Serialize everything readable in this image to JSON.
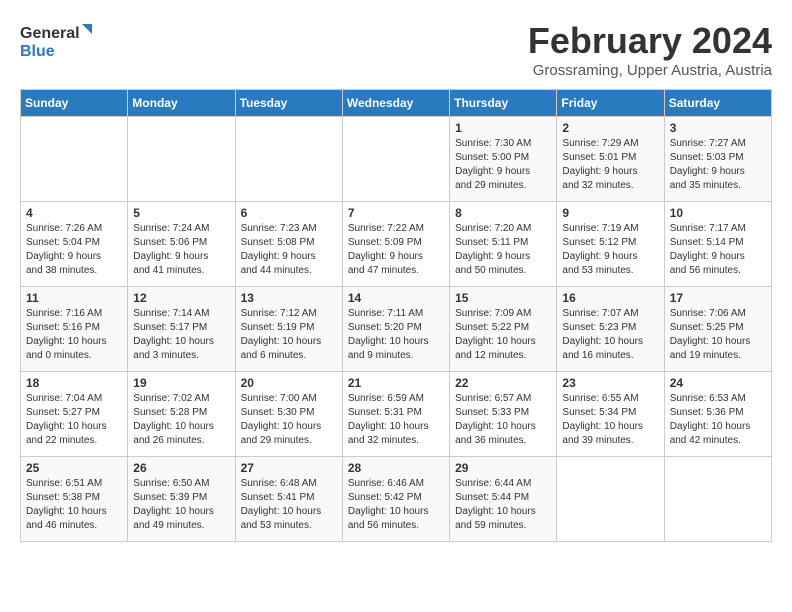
{
  "header": {
    "logo_line1": "General",
    "logo_line2": "Blue",
    "month_year": "February 2024",
    "location": "Grossraming, Upper Austria, Austria"
  },
  "days_of_week": [
    "Sunday",
    "Monday",
    "Tuesday",
    "Wednesday",
    "Thursday",
    "Friday",
    "Saturday"
  ],
  "weeks": [
    [
      {
        "day": "",
        "info": ""
      },
      {
        "day": "",
        "info": ""
      },
      {
        "day": "",
        "info": ""
      },
      {
        "day": "",
        "info": ""
      },
      {
        "day": "1",
        "info": "Sunrise: 7:30 AM\nSunset: 5:00 PM\nDaylight: 9 hours\nand 29 minutes."
      },
      {
        "day": "2",
        "info": "Sunrise: 7:29 AM\nSunset: 5:01 PM\nDaylight: 9 hours\nand 32 minutes."
      },
      {
        "day": "3",
        "info": "Sunrise: 7:27 AM\nSunset: 5:03 PM\nDaylight: 9 hours\nand 35 minutes."
      }
    ],
    [
      {
        "day": "4",
        "info": "Sunrise: 7:26 AM\nSunset: 5:04 PM\nDaylight: 9 hours\nand 38 minutes."
      },
      {
        "day": "5",
        "info": "Sunrise: 7:24 AM\nSunset: 5:06 PM\nDaylight: 9 hours\nand 41 minutes."
      },
      {
        "day": "6",
        "info": "Sunrise: 7:23 AM\nSunset: 5:08 PM\nDaylight: 9 hours\nand 44 minutes."
      },
      {
        "day": "7",
        "info": "Sunrise: 7:22 AM\nSunset: 5:09 PM\nDaylight: 9 hours\nand 47 minutes."
      },
      {
        "day": "8",
        "info": "Sunrise: 7:20 AM\nSunset: 5:11 PM\nDaylight: 9 hours\nand 50 minutes."
      },
      {
        "day": "9",
        "info": "Sunrise: 7:19 AM\nSunset: 5:12 PM\nDaylight: 9 hours\nand 53 minutes."
      },
      {
        "day": "10",
        "info": "Sunrise: 7:17 AM\nSunset: 5:14 PM\nDaylight: 9 hours\nand 56 minutes."
      }
    ],
    [
      {
        "day": "11",
        "info": "Sunrise: 7:16 AM\nSunset: 5:16 PM\nDaylight: 10 hours\nand 0 minutes."
      },
      {
        "day": "12",
        "info": "Sunrise: 7:14 AM\nSunset: 5:17 PM\nDaylight: 10 hours\nand 3 minutes."
      },
      {
        "day": "13",
        "info": "Sunrise: 7:12 AM\nSunset: 5:19 PM\nDaylight: 10 hours\nand 6 minutes."
      },
      {
        "day": "14",
        "info": "Sunrise: 7:11 AM\nSunset: 5:20 PM\nDaylight: 10 hours\nand 9 minutes."
      },
      {
        "day": "15",
        "info": "Sunrise: 7:09 AM\nSunset: 5:22 PM\nDaylight: 10 hours\nand 12 minutes."
      },
      {
        "day": "16",
        "info": "Sunrise: 7:07 AM\nSunset: 5:23 PM\nDaylight: 10 hours\nand 16 minutes."
      },
      {
        "day": "17",
        "info": "Sunrise: 7:06 AM\nSunset: 5:25 PM\nDaylight: 10 hours\nand 19 minutes."
      }
    ],
    [
      {
        "day": "18",
        "info": "Sunrise: 7:04 AM\nSunset: 5:27 PM\nDaylight: 10 hours\nand 22 minutes."
      },
      {
        "day": "19",
        "info": "Sunrise: 7:02 AM\nSunset: 5:28 PM\nDaylight: 10 hours\nand 26 minutes."
      },
      {
        "day": "20",
        "info": "Sunrise: 7:00 AM\nSunset: 5:30 PM\nDaylight: 10 hours\nand 29 minutes."
      },
      {
        "day": "21",
        "info": "Sunrise: 6:59 AM\nSunset: 5:31 PM\nDaylight: 10 hours\nand 32 minutes."
      },
      {
        "day": "22",
        "info": "Sunrise: 6:57 AM\nSunset: 5:33 PM\nDaylight: 10 hours\nand 36 minutes."
      },
      {
        "day": "23",
        "info": "Sunrise: 6:55 AM\nSunset: 5:34 PM\nDaylight: 10 hours\nand 39 minutes."
      },
      {
        "day": "24",
        "info": "Sunrise: 6:53 AM\nSunset: 5:36 PM\nDaylight: 10 hours\nand 42 minutes."
      }
    ],
    [
      {
        "day": "25",
        "info": "Sunrise: 6:51 AM\nSunset: 5:38 PM\nDaylight: 10 hours\nand 46 minutes."
      },
      {
        "day": "26",
        "info": "Sunrise: 6:50 AM\nSunset: 5:39 PM\nDaylight: 10 hours\nand 49 minutes."
      },
      {
        "day": "27",
        "info": "Sunrise: 6:48 AM\nSunset: 5:41 PM\nDaylight: 10 hours\nand 53 minutes."
      },
      {
        "day": "28",
        "info": "Sunrise: 6:46 AM\nSunset: 5:42 PM\nDaylight: 10 hours\nand 56 minutes."
      },
      {
        "day": "29",
        "info": "Sunrise: 6:44 AM\nSunset: 5:44 PM\nDaylight: 10 hours\nand 59 minutes."
      },
      {
        "day": "",
        "info": ""
      },
      {
        "day": "",
        "info": ""
      }
    ]
  ]
}
